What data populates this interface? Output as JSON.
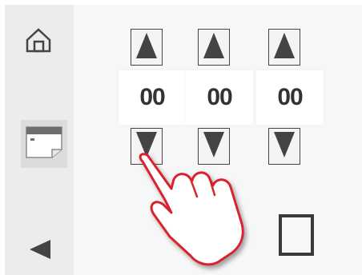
{
  "sidebar": {
    "home_icon": "home-icon",
    "calendar_icon": "calendar-icon",
    "back_icon": "back-triangle-icon"
  },
  "time_picker": {
    "spinners": [
      {
        "value": "00",
        "up_icon": "triangle-up-icon",
        "down_icon": "triangle-down-icon"
      },
      {
        "value": "00",
        "up_icon": "triangle-up-icon",
        "down_icon": "triangle-down-icon"
      },
      {
        "value": "00",
        "up_icon": "triangle-up-icon",
        "down_icon": "triangle-down-icon"
      }
    ]
  },
  "overlay": {
    "pointer_icon": "pointing-hand-icon"
  },
  "colors": {
    "sidebar_bg": "#ececec",
    "main_bg": "#f7f7f7",
    "icon_dark": "#444444",
    "hand_outline": "#d9232d"
  }
}
